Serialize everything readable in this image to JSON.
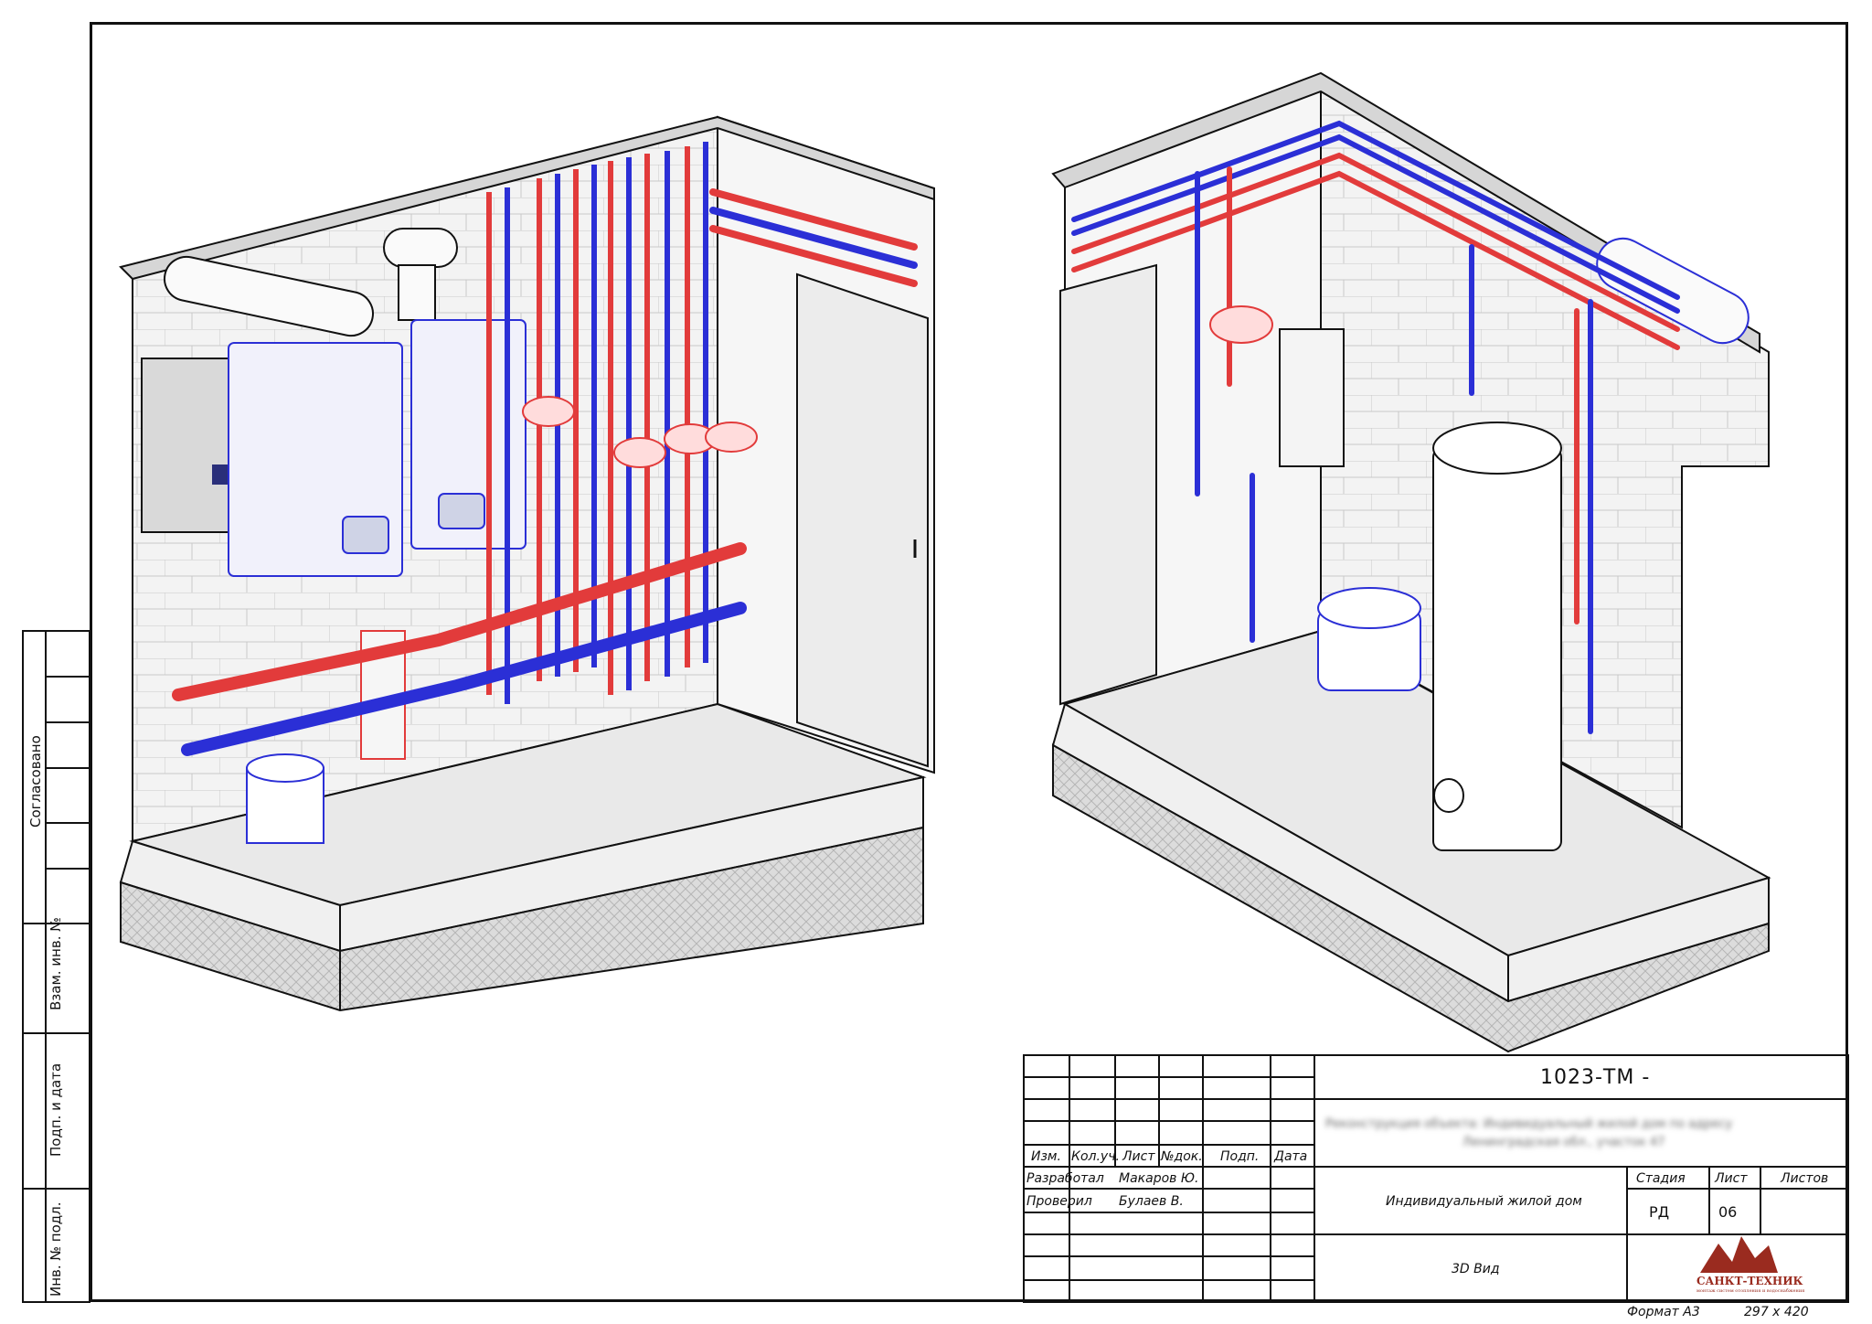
{
  "side_stamp": {
    "agreed": "Согласовано",
    "ref_no": "Взам. инв. №",
    "sign_date": "Подп. и дата",
    "orig_no": "Инв. № подл."
  },
  "title_block": {
    "code": "1023-ТМ -",
    "blurred_line1": "Реконструкция объекта: Индивидуальный жилой дом по адресу",
    "blurred_line2": "Ленинградская обл., участок 47",
    "headers": [
      "Изм.",
      "Кол.уч.",
      "Лист",
      "№док.",
      "Подп.",
      "Дата"
    ],
    "rows": [
      {
        "role": "Разработал",
        "name": "Макаров Ю."
      },
      {
        "role": "Проверил",
        "name": "Булаев В."
      }
    ],
    "object_name": "Индивидуальный жилой дом",
    "sheet_name": "3D Вид",
    "stage_label": "Стадия",
    "sheet_label": "Лист",
    "sheets_label": "Листов",
    "stage_value": "РД",
    "sheet_value": "06",
    "sheets_value": "",
    "logo_name": "САНКТ-ТЕХНИК",
    "logo_sub": "монтаж систем отопления и водоснабжения"
  },
  "footer": {
    "format": "Формат А3",
    "size": "297 x 420"
  },
  "colors": {
    "supply": "#e23b3b",
    "return": "#2b2fd6",
    "line": "#111111",
    "wall": "#f2f2f2",
    "floor": "#e8e8e8",
    "logo": "#9a2b1f"
  }
}
